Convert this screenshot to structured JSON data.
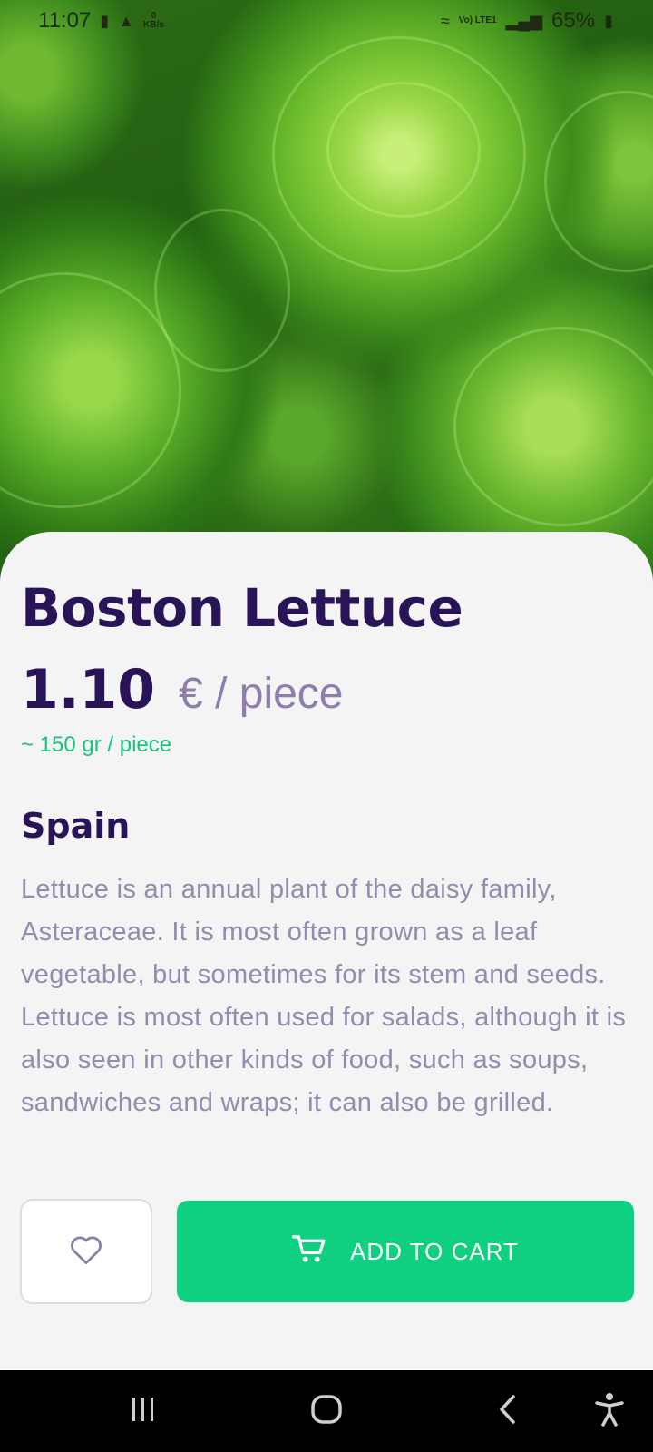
{
  "status_bar": {
    "time": "11:07",
    "net_speed_value": "0",
    "net_speed_unit": "KB/s",
    "network_label": "Vo) LTE1",
    "battery": "65%"
  },
  "product": {
    "name": "Boston Lettuce",
    "price": "1.10",
    "unit": "€ / piece",
    "weight": "~ 150 gr / piece",
    "origin": "Spain",
    "description": "Lettuce is an annual plant of the daisy family, Asteraceae. It is most often grown as a leaf vegetable, but sometimes for its stem and seeds. Lettuce is most often used for salads, although it is also seen in other kinds of food, such as soups, sandwiches and wraps; it can also be grilled."
  },
  "actions": {
    "add_to_cart_label": "ADD TO CART"
  },
  "icons": {
    "favorite": "heart-icon",
    "cart": "cart-icon",
    "recents": "recents-icon",
    "home": "home-icon",
    "back": "back-icon",
    "accessibility": "accessibility-icon"
  },
  "colors": {
    "title": "#2a1458",
    "accent_green": "#0fcf80",
    "muted_text": "#968aae"
  }
}
